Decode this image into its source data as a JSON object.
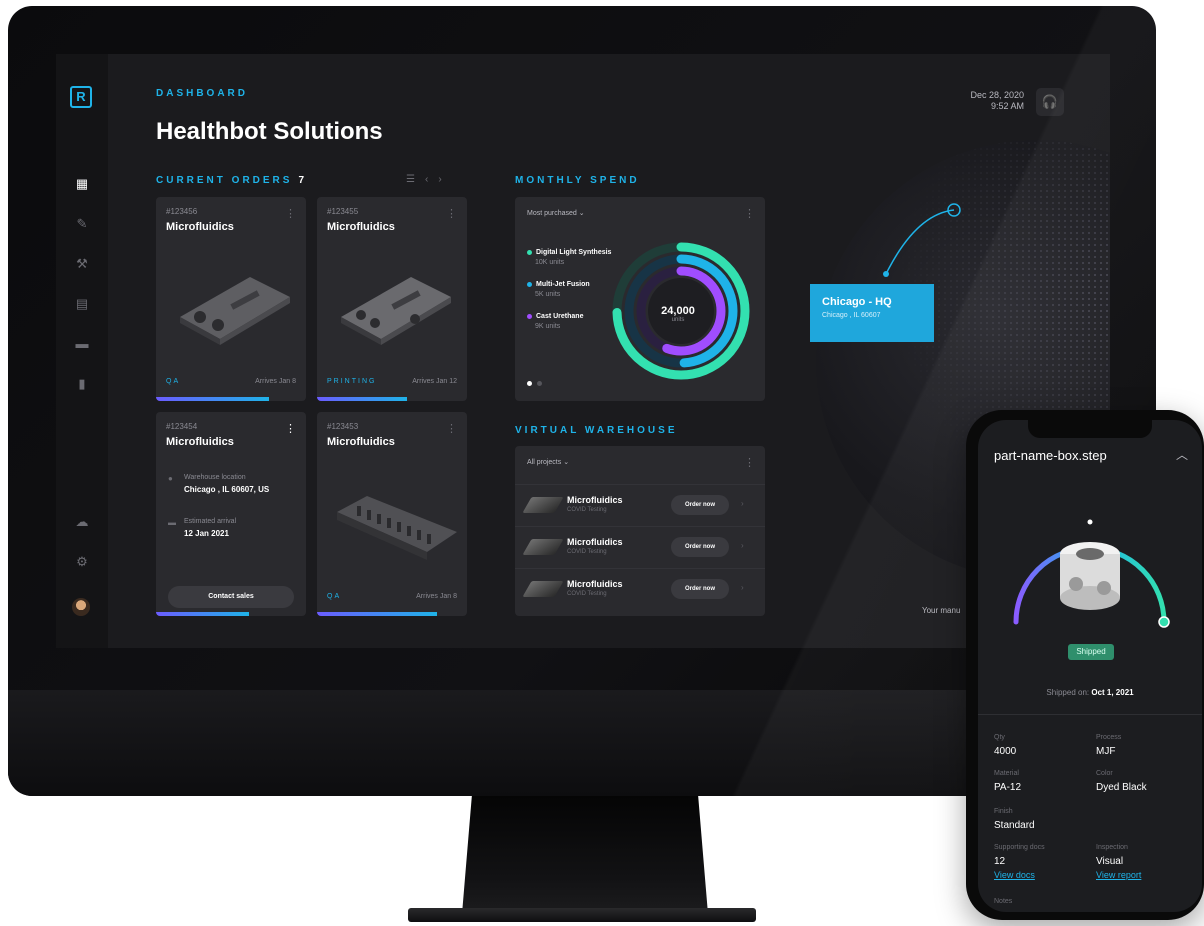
{
  "dashboard": {
    "eyebrow": "DASHBOARD",
    "title": "Healthbot Solutions",
    "date": "Dec 28, 2020",
    "time": "9:52 AM"
  },
  "orders": {
    "heading": "CURRENT ORDERS",
    "count": "7",
    "cards": [
      {
        "number": "#123456",
        "name": "Microfluidics",
        "status": "QA",
        "arrives": "Arrives Jan 8",
        "progress": 0.75
      },
      {
        "number": "#123455",
        "name": "Microfluidics",
        "status": "PRINTING",
        "arrives": "Arrives Jan 12",
        "progress": 0.6
      },
      {
        "number": "#123454",
        "name": "Microfluidics",
        "warehouse_label": "Warehouse location",
        "warehouse_value": "Chicago , IL 60607, US",
        "arrival_label": "Estimated arrival",
        "arrival_value": "12 Jan 2021",
        "button": "Contact sales",
        "progress": 0.62
      },
      {
        "number": "#123453",
        "name": "Microfluidics",
        "status": "QA",
        "arrives": "Arrives Jan 8",
        "progress": 0.8
      }
    ]
  },
  "monthly_spend": {
    "heading": "MONTHLY SPEND",
    "filter": "Most purchased",
    "total": "24,000",
    "total_unit": "units",
    "legend": [
      {
        "name": "Digital Light Synthesis",
        "units": "10K units",
        "color": "#33e0b0"
      },
      {
        "name": "Multi-Jet Fusion",
        "units": "5K units",
        "color": "#1fb3e8"
      },
      {
        "name": "Cast Urethane",
        "units": "9K units",
        "color": "#a04dff"
      }
    ]
  },
  "warehouse": {
    "heading": "VIRTUAL WAREHOUSE",
    "filter": "All projects",
    "rows": [
      {
        "name": "Microfluidics",
        "sub": "COVID Testing",
        "button": "Order now"
      },
      {
        "name": "Microfluidics",
        "sub": "COVID Testing",
        "button": "Order now"
      },
      {
        "name": "Microfluidics",
        "sub": "COVID Testing",
        "button": "Order now"
      }
    ]
  },
  "map": {
    "hq_name": "Chicago - HQ",
    "hq_address": "Chicago , IL 60607",
    "manu_text": "Your manu"
  },
  "phone": {
    "file_name": "part-name-box.step",
    "status": "Shipped",
    "shipped_label": "Shipped on:",
    "shipped_date": "Oct 1, 2021",
    "specs": [
      {
        "label": "Qty",
        "value": "4000"
      },
      {
        "label": "Process",
        "value": "MJF"
      },
      {
        "label": "Material",
        "value": "PA-12"
      },
      {
        "label": "Color",
        "value": "Dyed Black"
      },
      {
        "label": "Finish",
        "value": "Standard"
      },
      {
        "label": "Supporting docs",
        "value": "12",
        "link": "View docs"
      },
      {
        "label": "Inspection",
        "value": "Visual",
        "link": "View report"
      }
    ],
    "notes_label": "Notes"
  },
  "colors": {
    "accent": "#1fb3e8",
    "teal": "#33e0b0",
    "purple": "#a04dff"
  }
}
